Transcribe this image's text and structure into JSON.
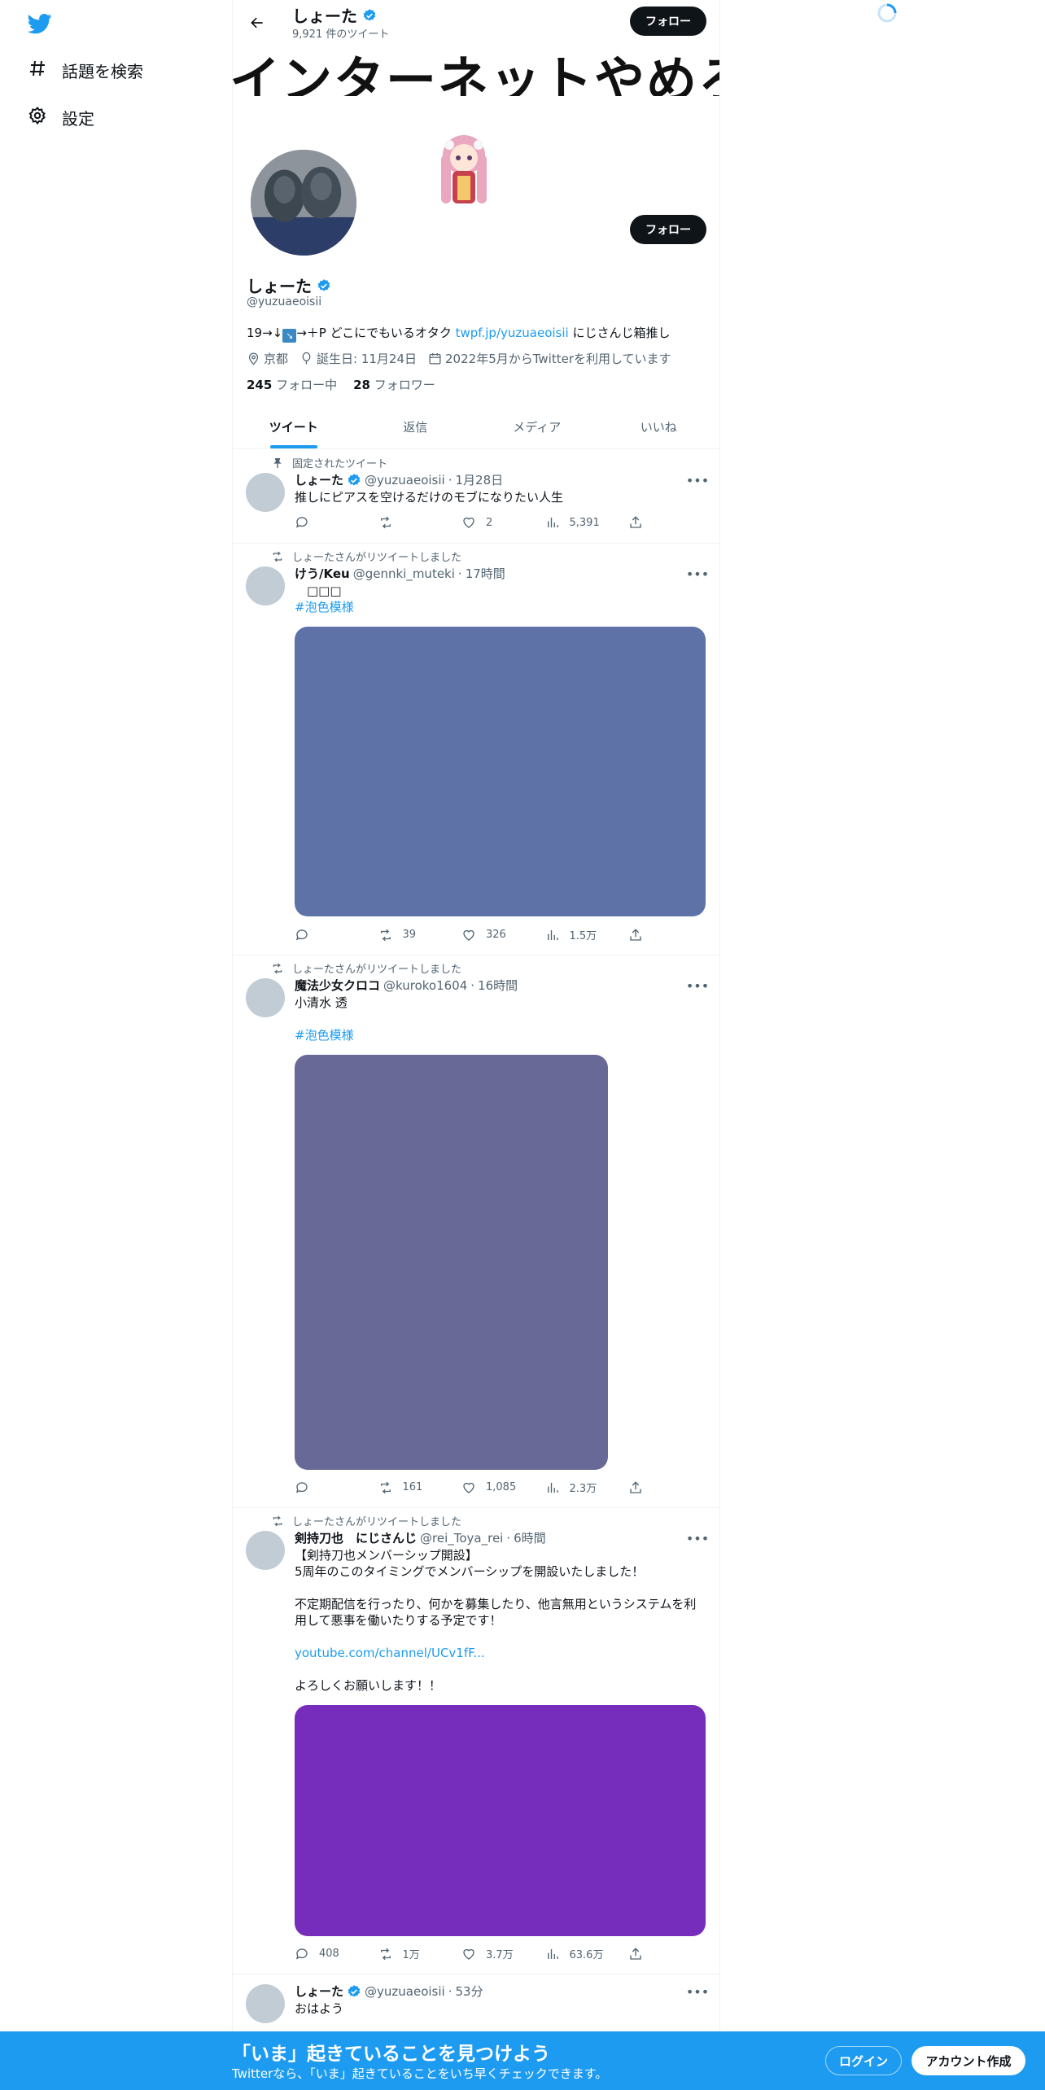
{
  "nav": {
    "explore_label": "話題を検索",
    "settings_label": "設定"
  },
  "header": {
    "name": "しょーた",
    "tweet_count": "9,921 件のツイート",
    "follow_label": "フォロー"
  },
  "banner": {
    "text": "インターネットやめろ"
  },
  "profile": {
    "name": "しょーた",
    "handle": "@yuzuaeoisii",
    "bio_prefix": "19→↓",
    "bio_middle": "→＋P どこにでもいるオタク ",
    "bio_link": "twpf.jp/yuzuaeoisii",
    "bio_suffix": " にじさんじ箱推し",
    "location": "京都",
    "birthday": "誕生日: 11月24日",
    "joined": "2022年5月からTwitterを利用しています",
    "following_count": "245",
    "following_label": "フォロー中",
    "followers_count": "28",
    "followers_label": "フォロワー",
    "follow_label": "フォロー"
  },
  "tabs": [
    "ツイート",
    "返信",
    "メディア",
    "いいね"
  ],
  "tweets": [
    {
      "context": "固定されたツイート",
      "name": "しょーた",
      "handle": "@yuzuaeoisii",
      "time": "1月28日",
      "text": "推しにピアスを空けるだけのモブになりたい人生",
      "reply": "",
      "retweet": "",
      "like": "2",
      "views": "5,391"
    },
    {
      "context": "しょーたさんがリツイートしました",
      "name": "けう/Keu",
      "handle": "@gennki_muteki",
      "time": "17時間",
      "text": "　□□□",
      "hashtag": "#泡色模様",
      "media_color": "#5e72a8",
      "reply": "",
      "retweet": "39",
      "like": "326",
      "views": "1.5万"
    },
    {
      "context": "しょーたさんがリツイートしました",
      "name": "魔法少女クロコ",
      "handle": "@kuroko1604",
      "time": "16時間",
      "text": "小清水 透",
      "hashtag": "#泡色模様",
      "media_color": "#686996",
      "reply": "",
      "retweet": "161",
      "like": "1,085",
      "views": "2.3万"
    },
    {
      "context": "しょーたさんがリツイートしました",
      "name": "剣持刀也　にじさんじ",
      "handle": "@rei_Toya_rei",
      "time": "6時間",
      "text_line1": "【剣持刀也メンバーシップ開設】",
      "text_line2": "5周年のこのタイミングでメンバーシップを開設いたしました！",
      "text_line3": "不定期配信を行ったり、何かを募集したり、他言無用というシステムを利用して悪事を働いたりする予定です！",
      "link": "youtube.com/channel/UCv1fF...",
      "text_line4": "よろしくお願いします！！",
      "media_color": "#772dbb",
      "reply": "408",
      "retweet": "1万",
      "like": "3.7万",
      "views": "63.6万"
    },
    {
      "name": "しょーた",
      "handle": "@yuzuaeoisii",
      "time": "53分",
      "text": "おはよう"
    }
  ],
  "bottom_bar": {
    "title": "「いま」起きていることを見つけよう",
    "subtitle": "Twitterなら、「いま」起きていることをいち早くチェックできます。",
    "login_label": "ログイン",
    "signup_label": "アカウント作成"
  },
  "colors": {
    "accent": "#1d9bf0",
    "text_primary": "#0f1419",
    "text_secondary": "#536471"
  }
}
